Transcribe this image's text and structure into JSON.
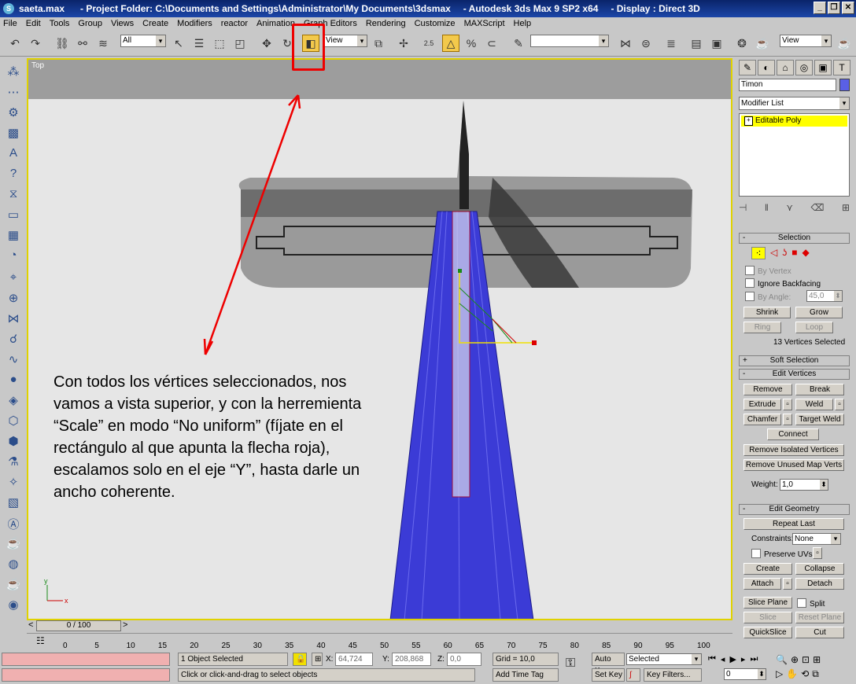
{
  "window": {
    "file": "saeta.max",
    "project": "- Project Folder: C:\\Documents and Settings\\Administrator\\My Documents\\3dsmax",
    "app": "- Autodesk 3ds Max 9 SP2 x64",
    "display": "- Display : Direct 3D"
  },
  "menu": [
    "File",
    "Edit",
    "Tools",
    "Group",
    "Views",
    "Create",
    "Modifiers",
    "reactor",
    "Animation",
    "Graph Editors",
    "Rendering",
    "Customize",
    "MAXScript",
    "Help"
  ],
  "toolbar": {
    "selection_filter": "All",
    "ref_coord": "View",
    "snap_value": "2.5",
    "named_sel": "",
    "render_view": "View"
  },
  "viewport": {
    "label": "Top",
    "axis_x": "x",
    "axis_y": "y",
    "annotation": "Con todos los vértices seleccionados, nos vamos a vista superior, y con la herremienta “Scale” en modo “No uniform” (fíjate en el rectángulo al que apunta la flecha roja), escalamos solo en el eje “Y”, hasta darle un ancho coherente."
  },
  "command_panel": {
    "object_name": "Timon",
    "object_color": "#5a60e6",
    "modifier_list": "Modifier List",
    "stack_item": "Editable Poly",
    "selection": {
      "title": "Selection",
      "by_vertex": "By Vertex",
      "ignore_backfacing": "Ignore Backfacing",
      "by_angle": "By Angle:",
      "by_angle_value": "45,0",
      "shrink": "Shrink",
      "grow": "Grow",
      "ring": "Ring",
      "loop": "Loop",
      "status": "13 Vertices Selected"
    },
    "soft_selection": "Soft Selection",
    "edit_vertices": {
      "title": "Edit Vertices",
      "remove": "Remove",
      "break": "Break",
      "extrude": "Extrude",
      "weld": "Weld",
      "chamfer": "Chamfer",
      "target_weld": "Target Weld",
      "connect": "Connect",
      "remove_isolated": "Remove Isolated Vertices",
      "remove_unused": "Remove Unused Map Verts",
      "weight_label": "Weight:",
      "weight_value": "1,0"
    },
    "edit_geometry": {
      "title": "Edit Geometry",
      "repeat_last": "Repeat Last",
      "constraints_label": "Constraints:",
      "constraints_value": "None",
      "preserve_uvs": "Preserve UVs",
      "create": "Create",
      "collapse": "Collapse",
      "attach": "Attach",
      "detach": "Detach",
      "slice_plane": "Slice Plane",
      "split": "Split",
      "slice": "Slice",
      "reset_plane": "Reset Plane",
      "quickslice": "QuickSlice",
      "cut": "Cut"
    }
  },
  "timeline": {
    "frame_display": "0 / 100",
    "ticks": [
      "0",
      "5",
      "10",
      "15",
      "20",
      "25",
      "30",
      "35",
      "40",
      "45",
      "50",
      "55",
      "60",
      "65",
      "70",
      "75",
      "80",
      "85",
      "90",
      "95",
      "100"
    ]
  },
  "status": {
    "selected": "1 Object Selected",
    "prompt": "Click or click-and-drag to select objects",
    "x_label": "X:",
    "x_value": "64,724",
    "y_label": "Y:",
    "y_value": "208,868",
    "z_label": "Z:",
    "z_value": "0,0",
    "grid": "Grid = 10,0",
    "add_time_tag": "Add Time Tag",
    "auto_key": "Auto Key",
    "set_key": "Set Key",
    "key_mode": "Selected",
    "key_filters": "Key Filters...",
    "frame": "0"
  }
}
